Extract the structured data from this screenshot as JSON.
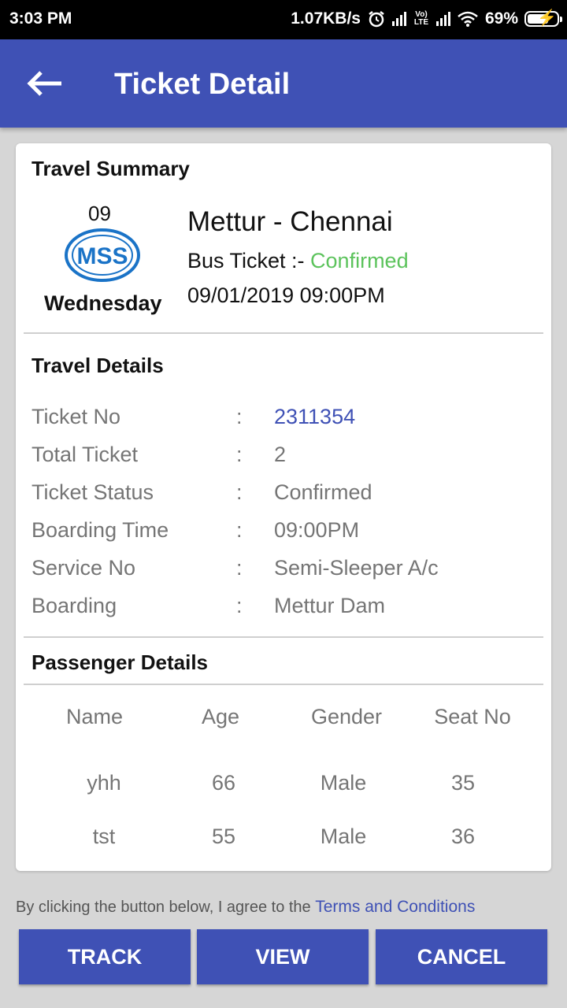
{
  "status_bar": {
    "time": "3:03 PM",
    "speed": "1.07KB/s",
    "volte": "Vo) LTE",
    "battery": "69%"
  },
  "app_bar": {
    "title": "Ticket Detail",
    "back_icon": "arrow-left-icon"
  },
  "summary": {
    "title": "Travel Summary",
    "date_num": "09",
    "logo_text": "MSS",
    "weekday": "Wednesday",
    "route": "Mettur - Chennai",
    "ticket_label": "Bus Ticket :- ",
    "ticket_status": "Confirmed",
    "datetime": "09/01/2019 09:00PM"
  },
  "travel_details": {
    "title": "Travel Details",
    "separator": ":",
    "rows": [
      {
        "label": "Ticket No",
        "value": "2311354"
      },
      {
        "label": "Total Ticket",
        "value": "2"
      },
      {
        "label": "Ticket Status",
        "value": "Confirmed"
      },
      {
        "label": "Boarding Time",
        "value": "09:00PM"
      },
      {
        "label": "Service No",
        "value": "Semi-Sleeper A/c"
      },
      {
        "label": "Boarding",
        "value": "Mettur Dam"
      }
    ]
  },
  "passengers": {
    "title": "Passenger Details",
    "headers": [
      "Name",
      "Age",
      "Gender",
      "Seat No"
    ],
    "rows": [
      [
        "yhh",
        "66",
        "Male",
        "35"
      ],
      [
        "tst",
        "55",
        "Male",
        "36"
      ]
    ]
  },
  "terms": {
    "text": "By clicking the button below, I agree to the ",
    "link": "Terms and Conditions"
  },
  "buttons": {
    "track": "TRACK",
    "view": "VIEW",
    "cancel": "CANCEL"
  },
  "colors": {
    "primary": "#3f51b5",
    "confirmed": "#5cc35c"
  }
}
